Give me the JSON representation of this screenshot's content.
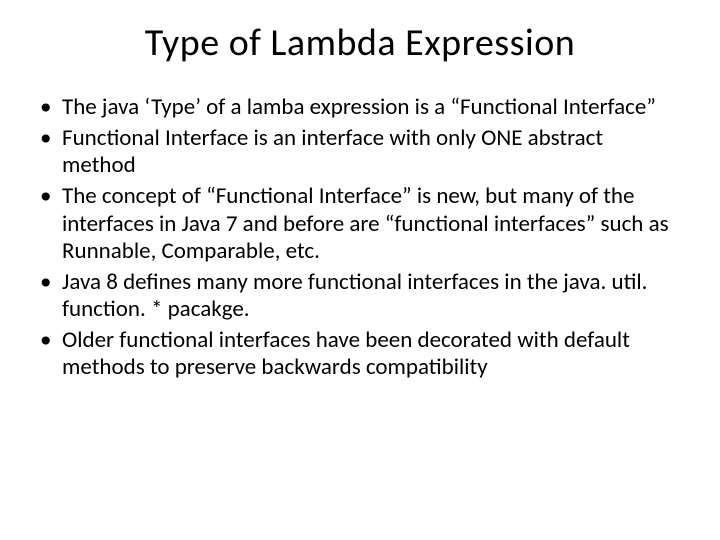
{
  "slide": {
    "title": "Type of Lambda Expression",
    "bullets": [
      "The java ‘Type’ of a lamba expression is a “Functional Interface”",
      "Functional Interface is an interface with only ONE abstract method",
      "The concept of “Functional Interface” is new, but many of the interfaces in Java 7 and before are “functional interfaces” such as Runnable, Comparable, etc.",
      "Java 8 defines many more functional interfaces in the java. util. function. * pacakge.",
      "Older functional interfaces have been decorated with default methods to preserve backwards compatibility"
    ]
  }
}
